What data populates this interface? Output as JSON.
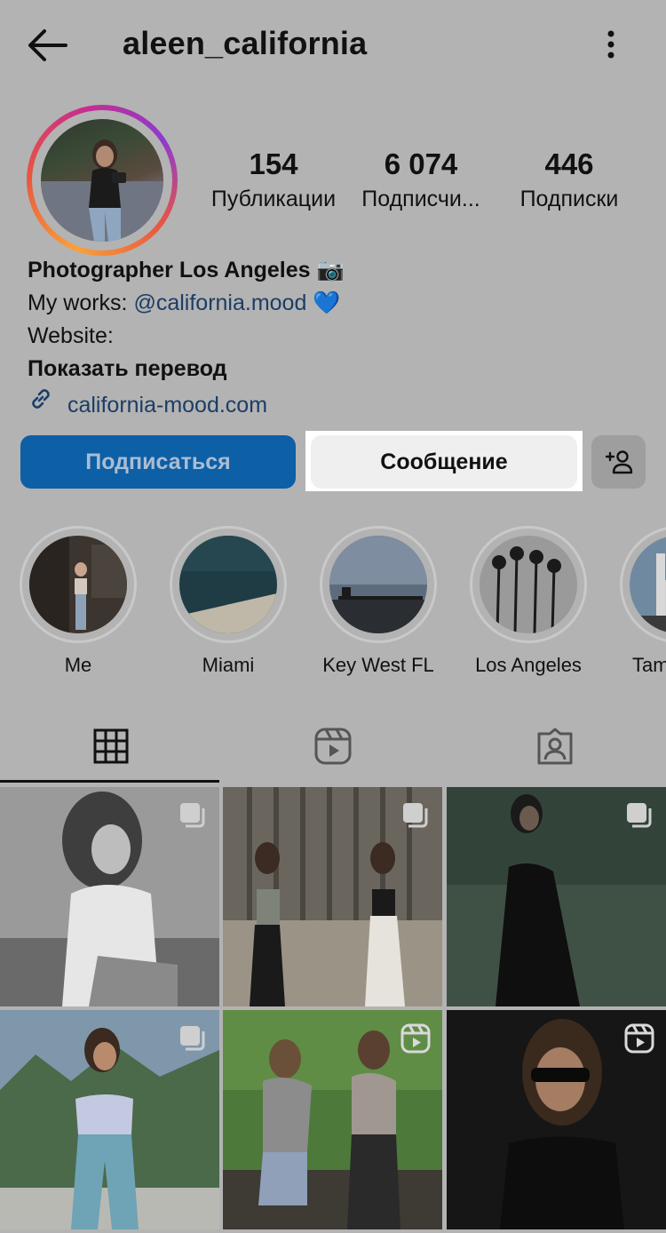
{
  "header": {
    "username": "aleen_california",
    "back_icon": "arrow-left-icon",
    "more_icon": "more-vertical-icon"
  },
  "stats": [
    {
      "value": "154",
      "label": "Публикации"
    },
    {
      "value": "6 074",
      "label": "Подписчи..."
    },
    {
      "value": "446",
      "label": "Подписки"
    }
  ],
  "bio": {
    "title": "Photographer Los Angeles 📷",
    "works_prefix": "My works: ",
    "works_link": "@california.mood",
    "works_emoji": " 💙",
    "website": "Website:",
    "translate": "Показать перевод",
    "url": "california-mood.com"
  },
  "buttons": {
    "follow": "Подписаться",
    "message": "Сообщение",
    "add_user_icon": "add-user-icon"
  },
  "highlights": [
    {
      "label": "Me"
    },
    {
      "label": "Miami"
    },
    {
      "label": "Key West FL"
    },
    {
      "label": "Los Angeles"
    },
    {
      "label": "Tam"
    }
  ],
  "tabs": [
    {
      "name": "grid",
      "icon": "grid-icon",
      "active": true
    },
    {
      "name": "reels",
      "icon": "reels-icon",
      "active": false
    },
    {
      "name": "tagged",
      "icon": "tagged-icon",
      "active": false
    }
  ],
  "posts": [
    {
      "type": "carousel"
    },
    {
      "type": "carousel"
    },
    {
      "type": "carousel"
    },
    {
      "type": "carousel"
    },
    {
      "type": "reel"
    },
    {
      "type": "reel"
    }
  ],
  "colors": {
    "background": "#b3b3b3",
    "follow_button": "#0d5fa6",
    "link": "#1c3d66"
  }
}
